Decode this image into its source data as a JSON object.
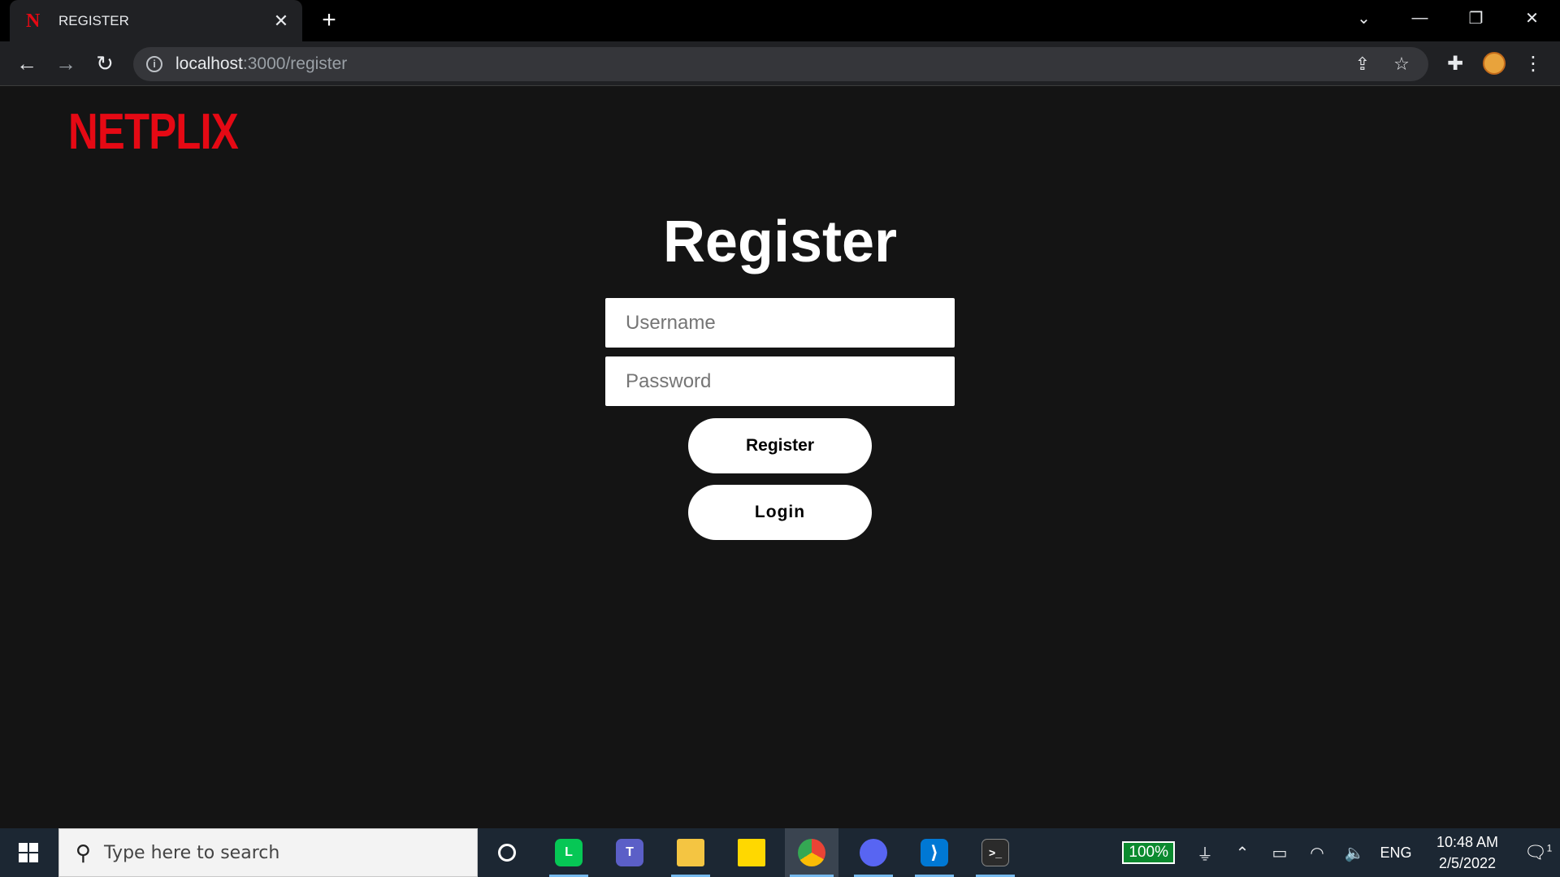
{
  "browser": {
    "tab_title": "REGISTER",
    "tab_favicon": "N",
    "url_host": "localhost",
    "url_path": ":3000/register",
    "icons": [
      "back-icon",
      "forward-icon",
      "reload-icon",
      "info-icon",
      "share-icon",
      "star-icon",
      "extensions-icon",
      "profile-avatar",
      "menu-icon"
    ]
  },
  "page": {
    "logo": "NETPLIX",
    "title": "Register",
    "username_placeholder": "Username",
    "password_placeholder": "Password",
    "register_label": "Register",
    "login_label": "Login",
    "colors": {
      "brand": "#e50914",
      "background": "#141414",
      "button": "#ffffff"
    }
  },
  "taskbar": {
    "search_placeholder": "Type here to search",
    "battery": "100%",
    "language": "ENG",
    "time": "10:48 AM",
    "date": "2/5/2022",
    "notifications": "1",
    "apps": [
      "cortana",
      "line",
      "teams",
      "file-explorer",
      "sticky-notes",
      "chrome",
      "discord",
      "vscode",
      "terminal"
    ]
  }
}
